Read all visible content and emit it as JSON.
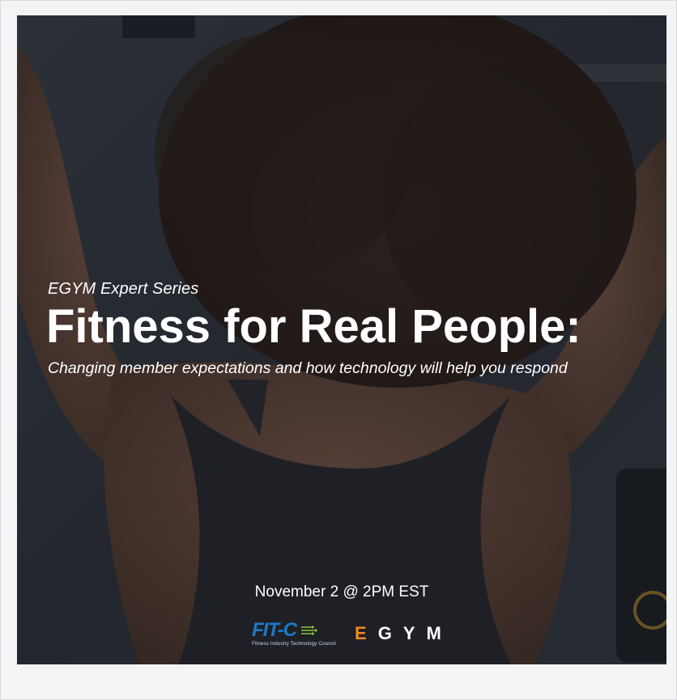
{
  "banner": {
    "eyebrow": "EGYM Expert Series",
    "headline": "Fitness for Real People:",
    "subhead": "Changing member expectations and how technology will help you respond",
    "date": "November 2 @ 2PM EST"
  },
  "logos": {
    "fitc_mark": "FIT-C",
    "fitc_tagline": "Fitness Industry Technology Council",
    "egym_first": "E",
    "egym_rest": "GYM"
  },
  "colors": {
    "background": "#f3f4f6",
    "fitc_blue": "#1f78c8",
    "egym_orange": "#f28c1c"
  }
}
